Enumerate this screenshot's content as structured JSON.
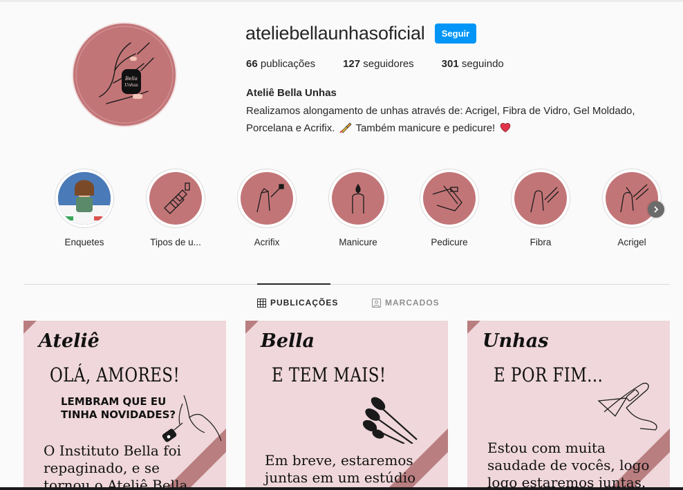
{
  "profile": {
    "username": "ateliebellaunhasoficial",
    "follow_label": "Seguir",
    "stats": {
      "posts_count": "66",
      "posts_label": " publicações",
      "followers_count": "127",
      "followers_label": " seguidores",
      "following_count": "301",
      "following_label": " seguindo"
    },
    "full_name": "Ateliê Bella Unhas",
    "bio_line1": "Realizamos alongamento de unhas através de: Acrigel, Fibra de Vidro, Gel Moldado,",
    "bio_line2a": "Porcelana e Acrifix. ",
    "bio_line2b": " Também manicure e pedicure! ",
    "avatar_text": "Bella Unhas"
  },
  "highlights": [
    {
      "label": "Enquetes"
    },
    {
      "label": "Tipos de u..."
    },
    {
      "label": "Acrifix"
    },
    {
      "label": "Manicure"
    },
    {
      "label": "Pedicure"
    },
    {
      "label": "Fibra"
    },
    {
      "label": "Acrigel"
    }
  ],
  "tabs": {
    "posts_label": "PUBLICAÇÕES",
    "tagged_label": "MARCADOS"
  },
  "posts": [
    {
      "script": "Ateliê",
      "headline": "OLÁ, AMORES!",
      "sub_line1": "LEMBRAM QUE EU",
      "sub_line2": "TINHA NOVIDADES?",
      "body_line1": "O Instituto Bella foi",
      "body_line2": "repaginado, e se",
      "body_line3": "tornou o Ateliê Bella"
    },
    {
      "script": "Bella",
      "headline": "E TEM MAIS!",
      "body_line1": "Em breve, estaremos",
      "body_line2": "juntas em um estúdio"
    },
    {
      "script": "Unhas",
      "headline": "E POR FIM...",
      "body_line1": "Estou com muita",
      "body_line2": "saudade de vocês, logo",
      "body_line3": "logo estaremos juntas."
    }
  ],
  "colors": {
    "brand_pink": "#c27577",
    "post_bg": "#efd7db",
    "follow_blue": "#0095f6"
  },
  "icons": {
    "grid": "grid-icon",
    "tagged": "tagged-icon",
    "next": "chevron-right-icon",
    "nail_polish_emoji": "nail-polish-icon",
    "heart_emoji": "heart-icon"
  }
}
